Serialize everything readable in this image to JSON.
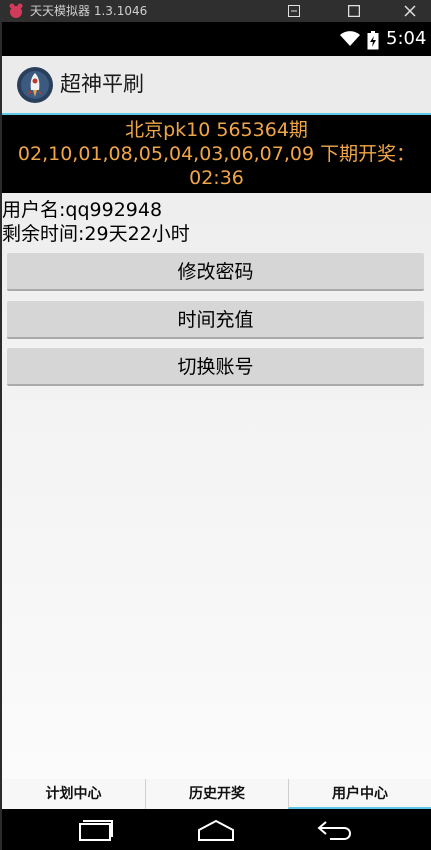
{
  "emulator": {
    "title": "天天模拟器 1.3.1046"
  },
  "status_bar": {
    "time": "5:04"
  },
  "action_bar": {
    "title": "超神平刷"
  },
  "banner": {
    "line1": "北京pk10 565364期",
    "line2": "02,10,01,08,05,04,03,06,07,09 下期开奖：",
    "line3": "02:36"
  },
  "user": {
    "username_line": "用户名:qq992948",
    "remaining_line": "剩余时间:29天22小时"
  },
  "buttons": {
    "change_password": "修改密码",
    "recharge": "时间充值",
    "switch_account": "切换账号"
  },
  "tabs": [
    {
      "label": "计划中心"
    },
    {
      "label": "历史开奖"
    },
    {
      "label": "用户中心",
      "selected": true
    }
  ],
  "colors": {
    "accent": "#5ec8e8",
    "banner_text": "#f0a648"
  }
}
